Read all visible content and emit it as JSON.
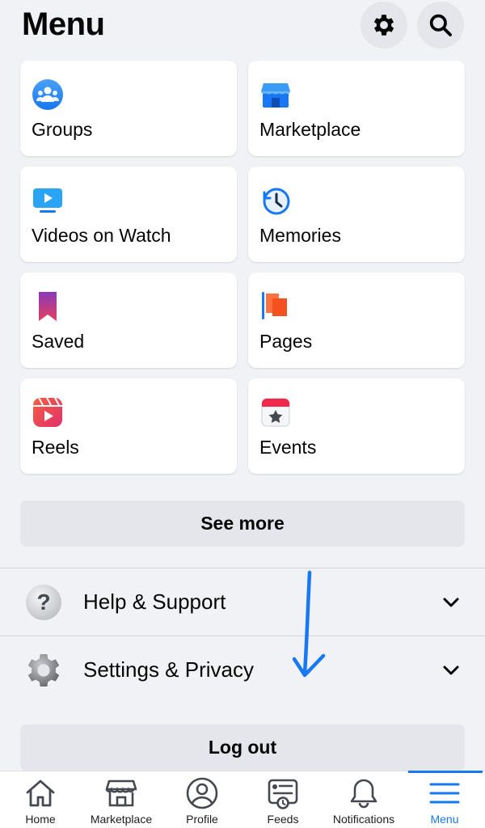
{
  "header": {
    "title": "Menu",
    "settings_icon": "gear-icon",
    "search_icon": "search-icon"
  },
  "shortcuts": [
    {
      "label": "Groups",
      "icon": "groups-icon"
    },
    {
      "label": "Marketplace",
      "icon": "marketplace-store-icon"
    },
    {
      "label": "Videos on Watch",
      "icon": "watch-video-icon"
    },
    {
      "label": "Memories",
      "icon": "memories-clock-icon"
    },
    {
      "label": "Saved",
      "icon": "saved-bookmark-icon"
    },
    {
      "label": "Pages",
      "icon": "pages-flag-icon"
    },
    {
      "label": "Reels",
      "icon": "reels-icon"
    },
    {
      "label": "Events",
      "icon": "events-calendar-icon"
    }
  ],
  "see_more_label": "See more",
  "sections": [
    {
      "label": "Help & Support",
      "icon": "help-question-icon"
    },
    {
      "label": "Settings & Privacy",
      "icon": "settings-gear-icon"
    }
  ],
  "logout_label": "Log out",
  "annotation": {
    "icon": "hand-drawn-arrow-down-icon",
    "color": "#1877f2"
  },
  "tabbar": {
    "active": "Menu",
    "tabs": [
      {
        "label": "Home",
        "icon": "home-icon"
      },
      {
        "label": "Marketplace",
        "icon": "marketplace-icon"
      },
      {
        "label": "Profile",
        "icon": "profile-icon"
      },
      {
        "label": "Feeds",
        "icon": "feeds-icon"
      },
      {
        "label": "Notifications",
        "icon": "bell-icon"
      },
      {
        "label": "Menu",
        "icon": "menu-icon"
      }
    ]
  },
  "colors": {
    "background": "#f0f2f5",
    "card": "#ffffff",
    "button": "#e4e6eb",
    "accent": "#1877f2"
  }
}
